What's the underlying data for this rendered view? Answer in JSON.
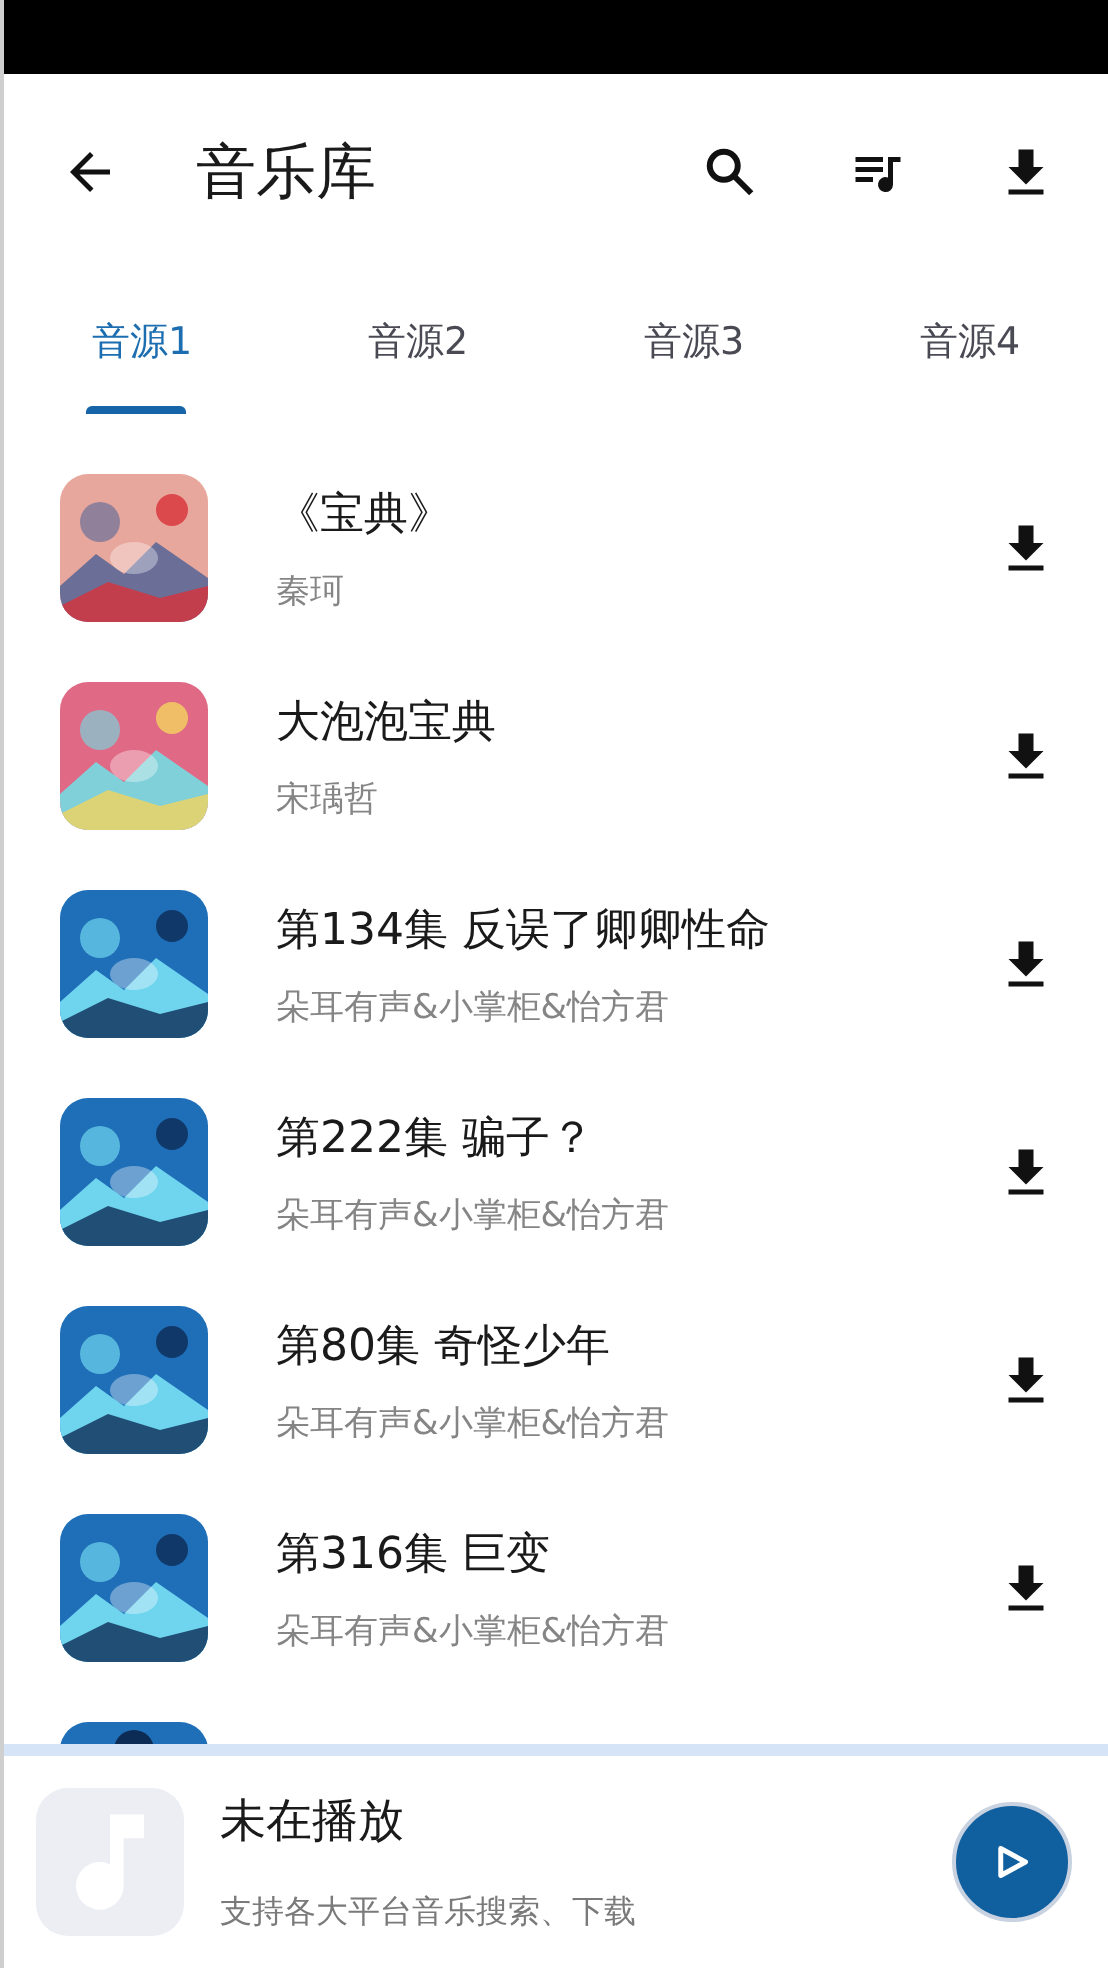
{
  "header": {
    "title": "音乐库"
  },
  "tabs": [
    {
      "label": "音源1",
      "selected": true
    },
    {
      "label": "音源2",
      "selected": false
    },
    {
      "label": "音源3",
      "selected": false
    },
    {
      "label": "音源4",
      "selected": false
    }
  ],
  "tracks": [
    {
      "title": "《宝典》",
      "artist": "秦珂"
    },
    {
      "title": "大泡泡宝典",
      "artist": "宋瑀哲"
    },
    {
      "title": "第134集 反误了卿卿性命",
      "artist": "朵耳有声&小掌柜&怡方君"
    },
    {
      "title": "第222集  骗子？",
      "artist": "朵耳有声&小掌柜&怡方君"
    },
    {
      "title": "第80集 奇怪少年",
      "artist": "朵耳有声&小掌柜&怡方君"
    },
    {
      "title": "第316集  巨变",
      "artist": "朵耳有声&小掌柜&怡方君"
    }
  ],
  "player": {
    "title": "未在播放",
    "subtitle": "支持各大平台音乐搜索、下载"
  }
}
